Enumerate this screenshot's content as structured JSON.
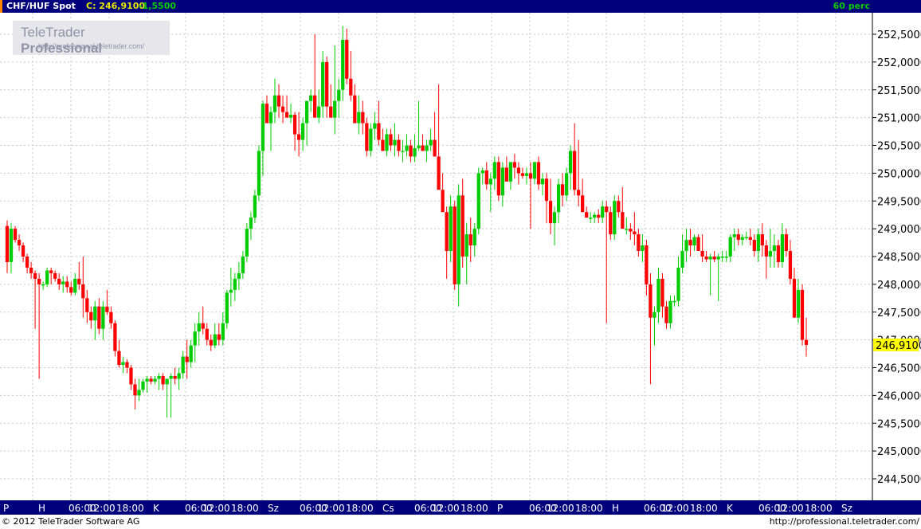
{
  "header": {
    "symbol": "CHF/HUF Spot",
    "close": "C: 246,9100",
    "change": "-1,5500",
    "period": "60 perc"
  },
  "logo": {
    "title_a": "TeleTrader ",
    "title_b": "Professional",
    "url": "http://professional.teletrader.com/"
  },
  "footer": {
    "copyright": "© 2012 TeleTrader Software AG",
    "url": "http://professional.teletrader.com/"
  },
  "colors": {
    "up": "#00cc00",
    "down": "#ff0000",
    "axis_bg": "#00007c",
    "last_label_bg": "#ffff00"
  },
  "chart_data": {
    "type": "candlestick",
    "ylim": [
      244.2,
      252.8
    ],
    "y_ticks": [
      "252,5000",
      "252,0000",
      "251,5000",
      "251,0000",
      "250,5000",
      "250,0000",
      "249,5000",
      "249,0000",
      "248,5000",
      "248,0000",
      "247,5000",
      "247,0000",
      "246,5000",
      "246,0000",
      "245,5000",
      "245,0000",
      "244,5000"
    ],
    "last_value": "246,9100",
    "grid": true,
    "x_axis_labels": [
      "P",
      "H",
      "06:00",
      "12:00",
      "18:00",
      "K",
      "06:00",
      "12:00",
      "18:00",
      "Sz",
      "06:00",
      "12:00",
      "18:00",
      "Cs",
      "06:00",
      "12:00",
      "18:00",
      "P",
      "06:00",
      "12:00",
      "18:00",
      "H",
      "06:00",
      "12:00",
      "18:00",
      "K",
      "06:00",
      "12:00",
      "18:00",
      "Sz"
    ],
    "candles": [
      [
        249.05,
        249.15,
        248.2,
        248.4
      ],
      [
        248.4,
        249.1,
        248.2,
        249.0
      ],
      [
        249.0,
        249.05,
        248.75,
        248.8
      ],
      [
        248.8,
        248.9,
        248.6,
        248.7
      ],
      [
        248.7,
        248.75,
        248.4,
        248.5
      ],
      [
        248.5,
        248.55,
        248.2,
        248.3
      ],
      [
        248.3,
        248.4,
        248.1,
        248.2
      ],
      [
        248.2,
        248.25,
        247.2,
        248.1
      ],
      [
        248.1,
        248.2,
        246.3,
        248.0
      ],
      [
        248.0,
        248.05,
        247.9,
        248.0
      ],
      [
        248.0,
        248.3,
        247.95,
        248.25
      ],
      [
        248.25,
        248.3,
        248.0,
        248.2
      ],
      [
        248.2,
        248.25,
        248.05,
        248.1
      ],
      [
        248.1,
        248.2,
        247.9,
        248.0
      ],
      [
        248.0,
        248.15,
        247.85,
        248.05
      ],
      [
        248.05,
        248.15,
        247.85,
        247.95
      ],
      [
        247.95,
        248.05,
        247.8,
        247.85
      ],
      [
        247.85,
        248.2,
        247.8,
        248.1
      ],
      [
        248.1,
        248.4,
        247.9,
        248.0
      ],
      [
        248.0,
        248.5,
        247.4,
        247.75
      ],
      [
        247.75,
        247.9,
        247.3,
        247.5
      ],
      [
        247.5,
        247.6,
        247.2,
        247.35
      ],
      [
        247.35,
        247.7,
        247.0,
        247.6
      ],
      [
        247.6,
        247.75,
        247.1,
        247.2
      ],
      [
        247.2,
        247.7,
        247.0,
        247.6
      ],
      [
        247.6,
        247.9,
        247.45,
        247.5
      ],
      [
        247.5,
        247.6,
        247.2,
        247.3
      ],
      [
        247.3,
        247.35,
        246.7,
        246.8
      ],
      [
        246.8,
        247.0,
        246.5,
        246.55
      ],
      [
        246.55,
        246.7,
        246.4,
        246.6
      ],
      [
        246.6,
        246.65,
        246.4,
        246.5
      ],
      [
        246.5,
        246.55,
        246.1,
        246.2
      ],
      [
        246.2,
        246.3,
        245.75,
        246.0
      ],
      [
        246.0,
        246.3,
        245.9,
        246.1
      ],
      [
        246.1,
        246.3,
        246.05,
        246.25
      ],
      [
        246.25,
        246.35,
        246.05,
        246.3
      ],
      [
        246.3,
        246.35,
        246.2,
        246.25
      ],
      [
        246.25,
        246.35,
        246.2,
        246.3
      ],
      [
        246.3,
        246.4,
        246.1,
        246.35
      ],
      [
        246.35,
        246.4,
        246.1,
        246.2
      ],
      [
        246.2,
        246.3,
        245.6,
        246.3
      ],
      [
        246.3,
        246.4,
        245.6,
        246.35
      ],
      [
        246.35,
        246.5,
        246.2,
        246.3
      ],
      [
        246.3,
        246.5,
        246.1,
        246.4
      ],
      [
        246.4,
        246.8,
        246.3,
        246.7
      ],
      [
        246.7,
        247.0,
        246.3,
        246.6
      ],
      [
        246.6,
        247.0,
        246.5,
        246.9
      ],
      [
        246.9,
        247.3,
        246.6,
        247.15
      ],
      [
        247.15,
        247.5,
        246.9,
        247.3
      ],
      [
        247.3,
        247.6,
        247.1,
        247.2
      ],
      [
        247.2,
        247.3,
        246.9,
        247.0
      ],
      [
        247.0,
        247.1,
        246.8,
        246.9
      ],
      [
        246.9,
        247.3,
        246.85,
        247.1
      ],
      [
        247.1,
        247.3,
        246.9,
        247.0
      ],
      [
        247.0,
        247.5,
        246.9,
        247.3
      ],
      [
        247.3,
        247.9,
        247.2,
        247.85
      ],
      [
        247.85,
        248.3,
        247.6,
        247.9
      ],
      [
        247.9,
        248.2,
        247.7,
        248.1
      ],
      [
        248.1,
        248.4,
        247.9,
        248.2
      ],
      [
        248.2,
        248.6,
        248.1,
        248.5
      ],
      [
        248.5,
        249.1,
        248.4,
        249.0
      ],
      [
        249.0,
        249.3,
        248.8,
        249.2
      ],
      [
        249.2,
        249.7,
        249.1,
        249.6
      ],
      [
        249.6,
        250.5,
        249.5,
        250.4
      ],
      [
        250.4,
        251.3,
        249.95,
        251.25
      ],
      [
        251.25,
        251.4,
        250.9,
        250.9
      ],
      [
        250.9,
        251.2,
        250.4,
        251.1
      ],
      [
        251.1,
        251.7,
        250.9,
        251.4
      ],
      [
        251.4,
        251.6,
        251.0,
        251.2
      ],
      [
        251.2,
        251.4,
        250.9,
        251.1
      ],
      [
        251.1,
        251.4,
        251.0,
        251.0
      ],
      [
        251.0,
        251.25,
        250.9,
        251.05
      ],
      [
        251.05,
        251.1,
        250.4,
        250.7
      ],
      [
        250.7,
        251.1,
        250.3,
        250.6
      ],
      [
        250.6,
        251.0,
        250.4,
        250.9
      ],
      [
        250.9,
        251.3,
        250.5,
        251.3
      ],
      [
        251.3,
        251.5,
        251.1,
        251.4
      ],
      [
        251.4,
        252.5,
        251.2,
        251.0
      ],
      [
        251.0,
        251.5,
        250.9,
        251.2
      ],
      [
        251.2,
        252.2,
        251.0,
        252.0
      ],
      [
        252.0,
        252.1,
        251.0,
        251.2
      ],
      [
        251.2,
        251.6,
        251.0,
        251.0
      ],
      [
        251.0,
        252.3,
        250.7,
        251.3
      ],
      [
        251.3,
        251.7,
        251.0,
        251.5
      ],
      [
        251.5,
        252.65,
        251.3,
        252.4
      ],
      [
        252.4,
        252.6,
        251.6,
        251.7
      ],
      [
        251.7,
        252.2,
        251.3,
        251.4
      ],
      [
        251.4,
        251.6,
        250.9,
        250.9
      ],
      [
        250.9,
        251.4,
        250.7,
        251.1
      ],
      [
        251.1,
        251.3,
        250.7,
        250.9
      ],
      [
        250.9,
        251.0,
        250.3,
        250.4
      ],
      [
        250.4,
        250.9,
        250.3,
        250.8
      ],
      [
        250.8,
        251.1,
        250.6,
        250.9
      ],
      [
        250.9,
        251.3,
        250.5,
        250.6
      ],
      [
        250.6,
        250.8,
        250.4,
        250.4
      ],
      [
        250.4,
        250.8,
        250.3,
        250.7
      ],
      [
        250.7,
        250.8,
        250.4,
        250.5
      ],
      [
        250.5,
        250.9,
        250.3,
        250.6
      ],
      [
        250.6,
        250.7,
        250.3,
        250.4
      ],
      [
        250.4,
        250.6,
        250.2,
        250.4
      ],
      [
        250.4,
        250.7,
        250.3,
        250.5
      ],
      [
        250.5,
        250.6,
        250.2,
        250.3
      ],
      [
        250.3,
        250.7,
        250.2,
        250.45
      ],
      [
        250.45,
        251.3,
        250.4,
        250.5
      ],
      [
        250.5,
        250.7,
        250.4,
        250.4
      ],
      [
        250.4,
        250.6,
        250.2,
        250.5
      ],
      [
        250.5,
        250.8,
        250.4,
        250.6
      ],
      [
        250.6,
        251.1,
        250.3,
        250.3
      ],
      [
        250.3,
        251.6,
        250.2,
        249.7
      ],
      [
        249.7,
        250.0,
        249.3,
        249.3
      ],
      [
        249.3,
        249.4,
        248.1,
        248.6
      ],
      [
        248.6,
        249.6,
        248.4,
        249.4
      ],
      [
        249.4,
        249.5,
        247.9,
        248.0
      ],
      [
        248.0,
        249.8,
        247.6,
        249.6
      ],
      [
        249.6,
        249.9,
        248.3,
        248.5
      ],
      [
        248.5,
        249.1,
        248.0,
        248.9
      ],
      [
        248.9,
        249.2,
        248.4,
        248.7
      ],
      [
        248.7,
        249.1,
        248.5,
        249.0
      ],
      [
        249.0,
        250.1,
        248.9,
        250.0
      ],
      [
        250.0,
        250.1,
        249.8,
        250.05
      ],
      [
        250.05,
        250.2,
        249.7,
        249.8
      ],
      [
        249.8,
        250.0,
        249.3,
        249.9
      ],
      [
        249.9,
        250.3,
        249.7,
        250.2
      ],
      [
        250.2,
        250.3,
        249.5,
        249.6
      ],
      [
        249.6,
        250.2,
        249.4,
        250.1
      ],
      [
        250.1,
        250.3,
        249.9,
        249.85
      ],
      [
        249.85,
        250.2,
        249.7,
        250.2
      ],
      [
        250.2,
        250.35,
        249.9,
        250.1
      ],
      [
        250.1,
        250.2,
        249.8,
        250.0
      ],
      [
        250.0,
        250.1,
        249.9,
        249.95
      ],
      [
        249.95,
        250.1,
        249.8,
        250.0
      ],
      [
        250.0,
        250.2,
        249.0,
        249.9
      ],
      [
        249.9,
        250.2,
        249.8,
        250.2
      ],
      [
        250.2,
        250.3,
        249.7,
        249.8
      ],
      [
        249.8,
        250.0,
        249.6,
        249.9
      ],
      [
        249.9,
        250.0,
        249.1,
        249.5
      ],
      [
        249.5,
        249.9,
        248.9,
        249.1
      ],
      [
        249.1,
        249.4,
        248.7,
        249.3
      ],
      [
        249.3,
        249.9,
        249.1,
        249.8
      ],
      [
        249.8,
        250.0,
        249.4,
        249.6
      ],
      [
        249.6,
        250.1,
        249.5,
        250.0
      ],
      [
        250.0,
        250.5,
        249.7,
        250.4
      ],
      [
        250.4,
        250.9,
        249.6,
        249.7
      ],
      [
        249.7,
        250.6,
        249.4,
        249.6
      ],
      [
        249.6,
        249.9,
        249.3,
        249.3
      ],
      [
        249.3,
        249.4,
        249.2,
        249.2
      ],
      [
        249.2,
        249.3,
        249.1,
        249.2
      ],
      [
        249.2,
        249.3,
        249.1,
        249.25
      ],
      [
        249.25,
        249.35,
        249.1,
        249.2
      ],
      [
        249.2,
        249.5,
        249.1,
        249.4
      ],
      [
        249.4,
        249.5,
        247.3,
        249.3
      ],
      [
        249.3,
        249.4,
        248.8,
        248.9
      ],
      [
        248.9,
        249.6,
        248.8,
        249.5
      ],
      [
        249.5,
        249.6,
        249.2,
        249.3
      ],
      [
        249.3,
        249.75,
        249.2,
        249.0
      ],
      [
        249.0,
        249.2,
        248.9,
        249.0
      ],
      [
        249.0,
        249.1,
        248.8,
        248.95
      ],
      [
        248.95,
        249.3,
        248.7,
        248.9
      ],
      [
        248.9,
        249.0,
        248.5,
        248.6
      ],
      [
        248.6,
        248.9,
        248.4,
        248.7
      ],
      [
        248.7,
        248.8,
        247.8,
        248.0
      ],
      [
        248.0,
        248.2,
        246.2,
        247.4
      ],
      [
        247.4,
        247.6,
        246.9,
        247.5
      ],
      [
        247.5,
        248.3,
        247.3,
        248.1
      ],
      [
        248.1,
        248.2,
        247.4,
        247.6
      ],
      [
        247.6,
        247.7,
        247.2,
        247.3
      ],
      [
        247.3,
        247.8,
        247.2,
        247.7
      ],
      [
        247.7,
        247.8,
        247.6,
        247.7
      ],
      [
        247.7,
        248.5,
        247.6,
        248.3
      ],
      [
        248.3,
        248.9,
        248.2,
        248.6
      ],
      [
        248.6,
        249.0,
        248.4,
        248.8
      ],
      [
        248.8,
        249.0,
        248.5,
        248.7
      ],
      [
        248.7,
        248.9,
        248.6,
        248.85
      ],
      [
        248.85,
        248.9,
        248.6,
        248.6
      ],
      [
        248.6,
        248.9,
        248.4,
        248.5
      ],
      [
        248.5,
        248.6,
        248.4,
        248.45
      ],
      [
        248.45,
        248.55,
        247.8,
        248.5
      ],
      [
        248.5,
        248.6,
        248.4,
        248.45
      ],
      [
        248.45,
        248.55,
        247.7,
        248.5
      ],
      [
        248.5,
        248.6,
        248.4,
        248.5
      ],
      [
        248.5,
        248.6,
        248.4,
        248.5
      ],
      [
        248.5,
        248.9,
        248.4,
        248.85
      ],
      [
        248.85,
        249.0,
        248.6,
        248.9
      ],
      [
        248.9,
        249.0,
        248.7,
        248.8
      ],
      [
        248.8,
        248.9,
        248.7,
        248.85
      ],
      [
        248.85,
        248.95,
        248.8,
        248.85
      ],
      [
        248.85,
        249.0,
        248.7,
        248.8
      ],
      [
        248.8,
        248.9,
        248.5,
        248.6
      ],
      [
        248.6,
        249.0,
        248.4,
        248.9
      ],
      [
        248.9,
        249.1,
        248.5,
        248.7
      ],
      [
        248.7,
        248.8,
        248.1,
        248.5
      ],
      [
        248.5,
        249.0,
        248.3,
        248.6
      ],
      [
        248.6,
        248.9,
        248.3,
        248.7
      ],
      [
        248.7,
        248.8,
        248.3,
        248.4
      ],
      [
        248.4,
        249.1,
        248.3,
        248.9
      ],
      [
        248.9,
        249.0,
        248.5,
        248.6
      ],
      [
        248.6,
        248.8,
        248.0,
        248.1
      ],
      [
        248.1,
        248.3,
        247.4,
        247.4
      ],
      [
        247.4,
        248.1,
        247.3,
        247.9
      ],
      [
        247.9,
        248.0,
        246.9,
        247.0
      ],
      [
        247.0,
        247.4,
        246.7,
        246.91
      ]
    ]
  }
}
